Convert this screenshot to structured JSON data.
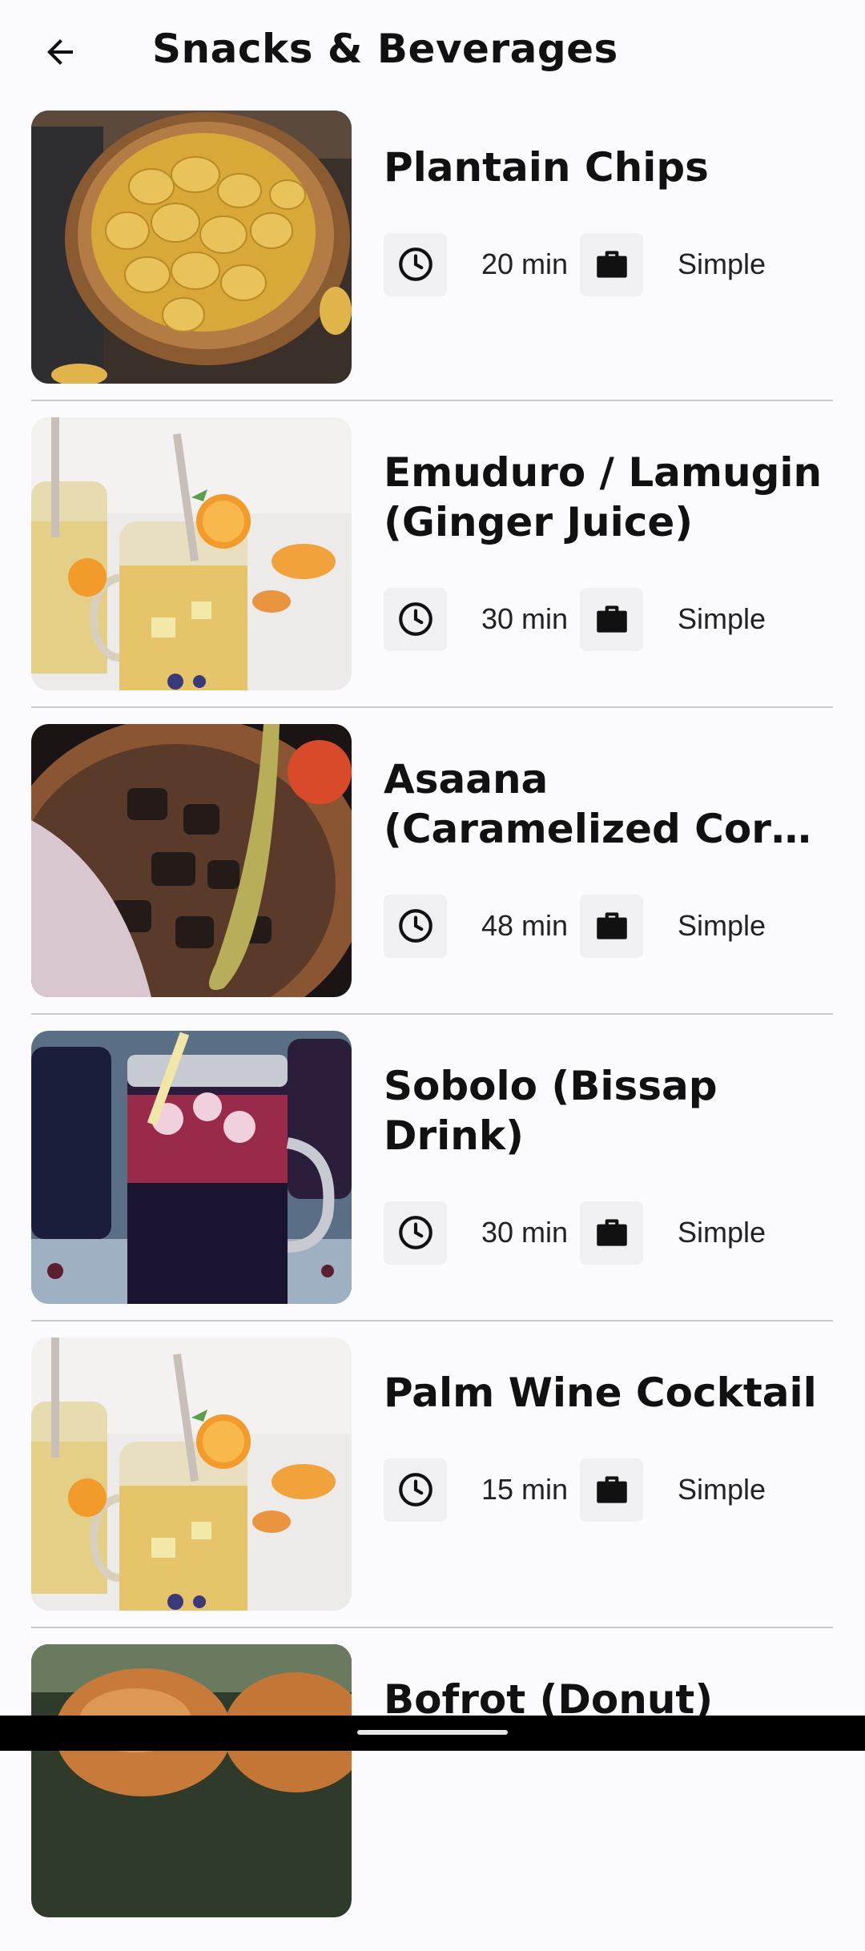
{
  "header": {
    "title": "Snacks & Beverages",
    "back_icon": "arrow-left-icon"
  },
  "icons": {
    "time": "clock-icon",
    "difficulty": "briefcase-icon"
  },
  "recipes": [
    {
      "title": "Plantain Chips",
      "time": "20 min",
      "difficulty": "Simple"
    },
    {
      "title": "Emuduro / Lamugin (Ginger Juice)",
      "time": "30 min",
      "difficulty": "Simple"
    },
    {
      "title": "Asaana (Caramelized Corn ...",
      "time": "48 min",
      "difficulty": "Simple"
    },
    {
      "title": "Sobolo (Bissap Drink)",
      "time": "30 min",
      "difficulty": "Simple"
    },
    {
      "title": "Palm Wine Cocktail",
      "time": "15 min",
      "difficulty": "Simple"
    },
    {
      "title": "Bofrot (Donut)",
      "time": "",
      "difficulty": ""
    }
  ]
}
